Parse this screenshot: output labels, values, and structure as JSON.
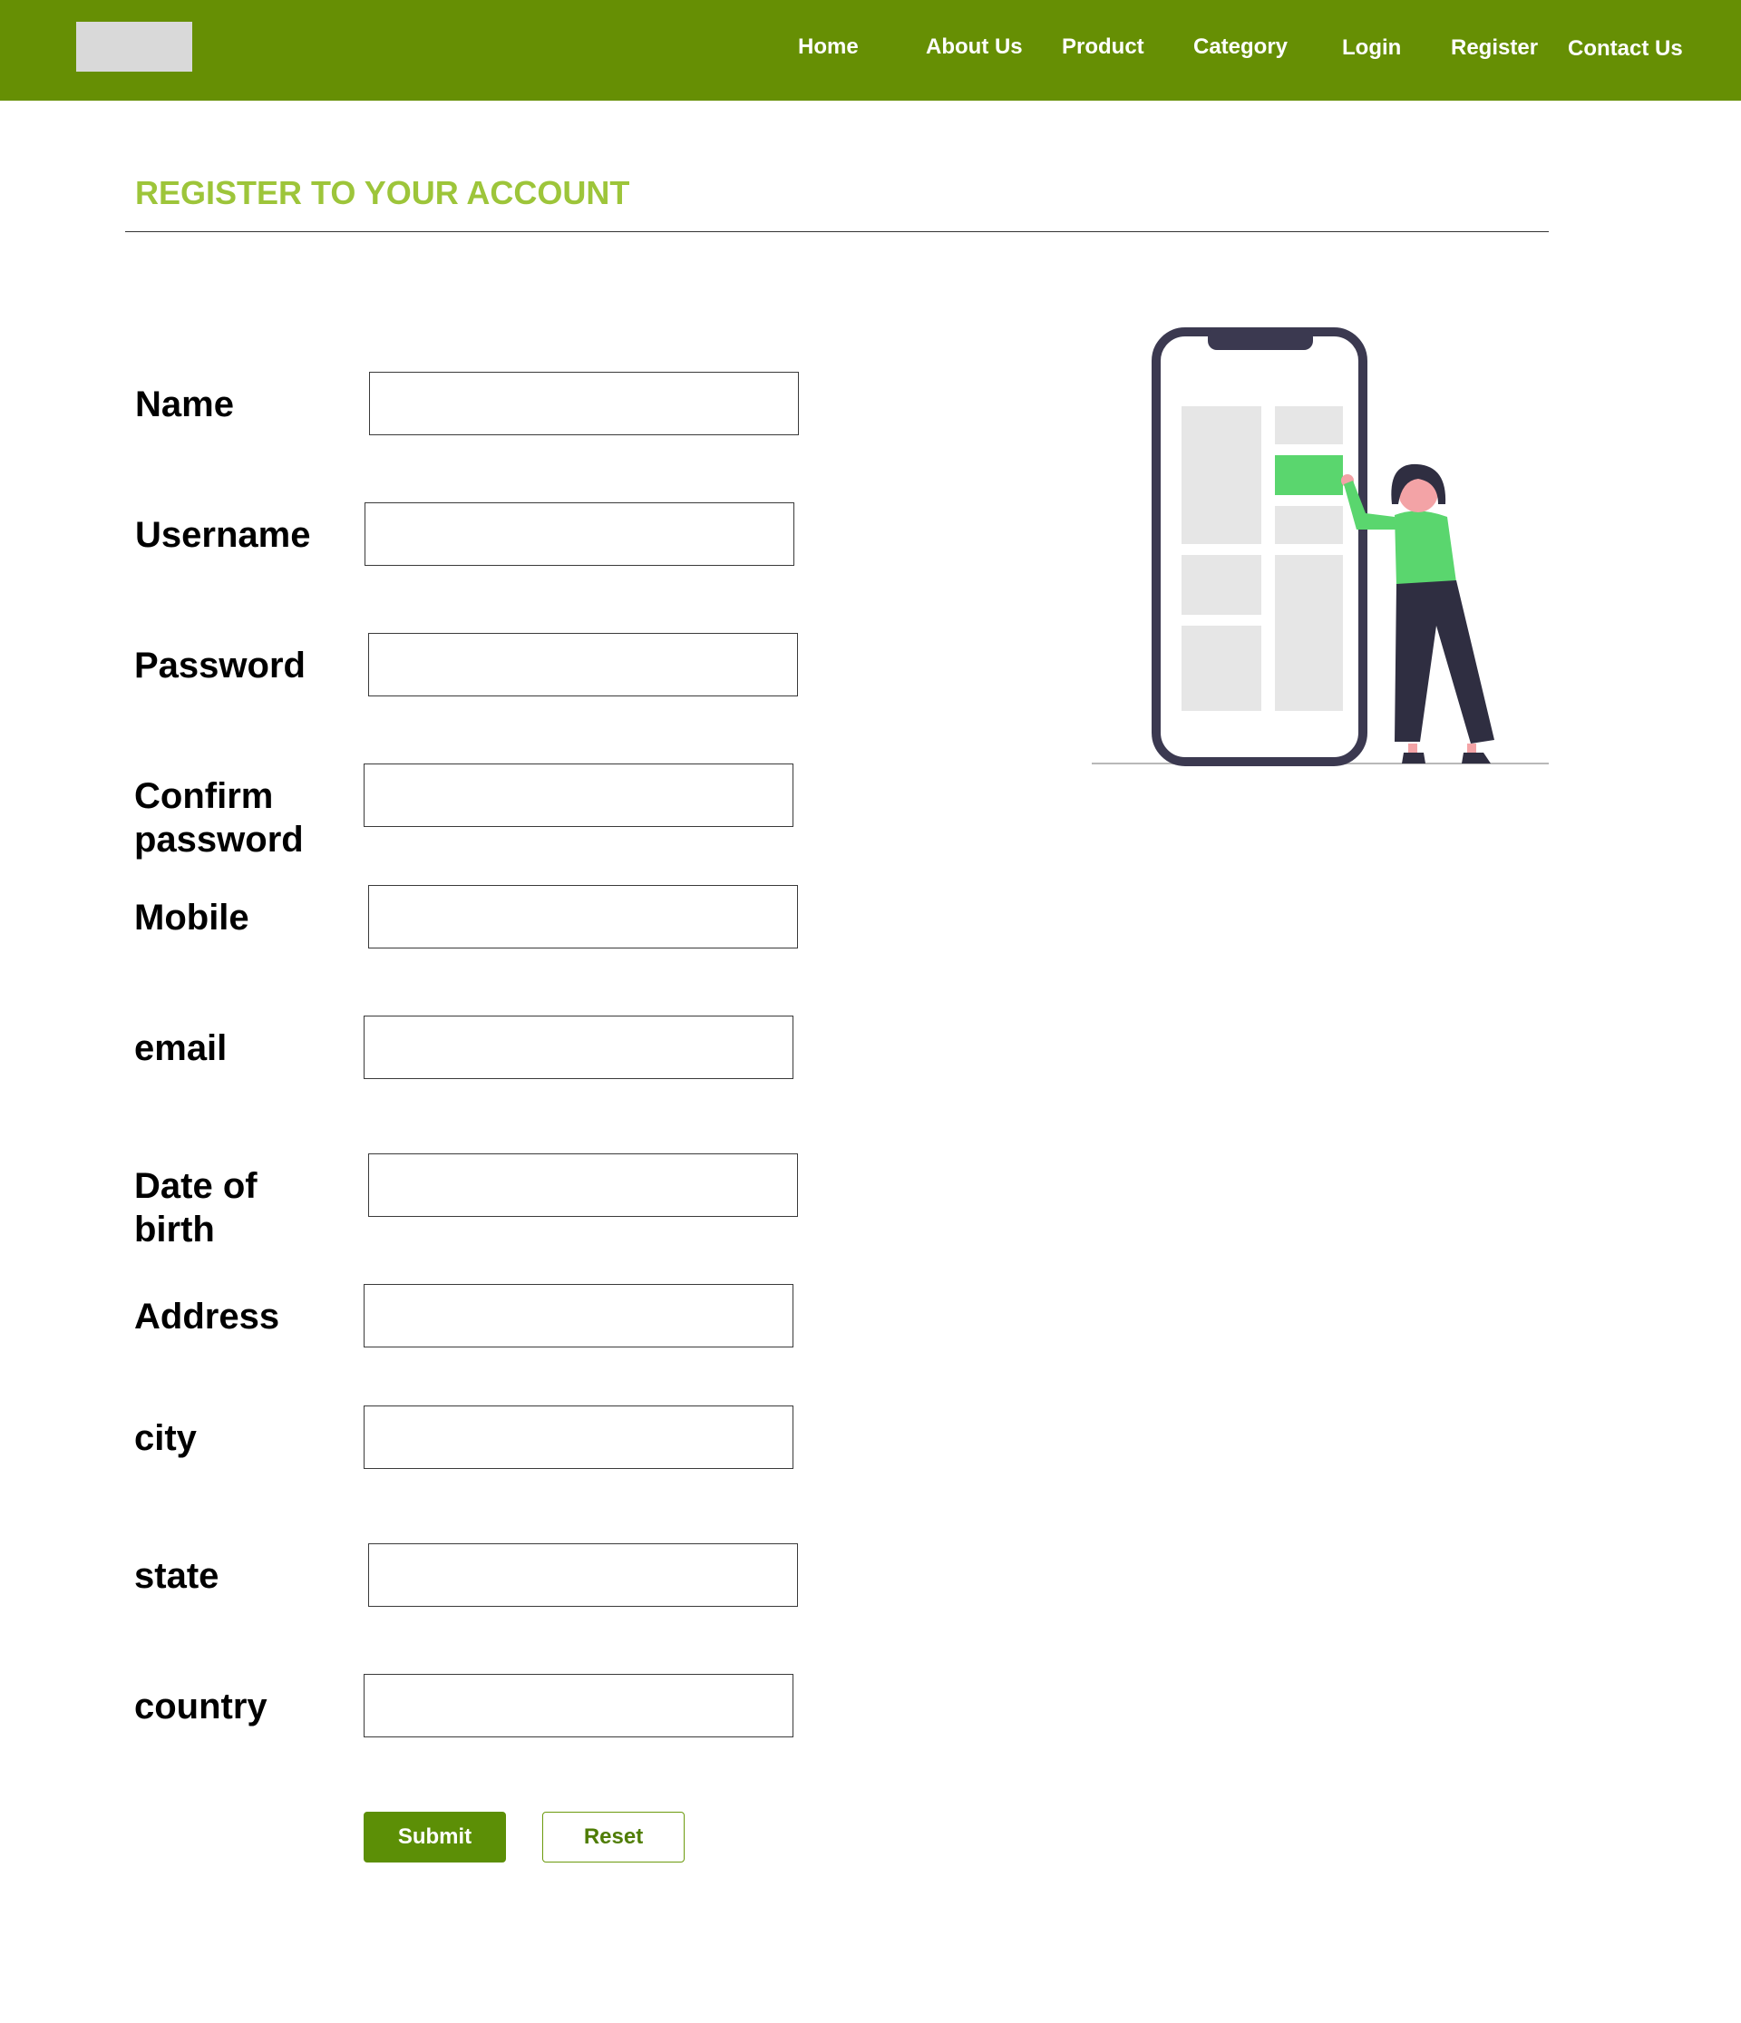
{
  "header": {
    "nav": [
      "Home",
      "About Us",
      "Product",
      "Category",
      "Login",
      "Register",
      "Contact Us"
    ]
  },
  "page": {
    "title": "REGISTER TO YOUR ACCOUNT"
  },
  "form": {
    "fields": [
      {
        "label": "Name",
        "value": ""
      },
      {
        "label": "Username",
        "value": ""
      },
      {
        "label": "Password",
        "value": ""
      },
      {
        "label": "Confirm password",
        "value": ""
      },
      {
        "label": "Mobile",
        "value": ""
      },
      {
        "label": "email",
        "value": ""
      },
      {
        "label": "Date of birth",
        "value": ""
      },
      {
        "label": "Address",
        "value": ""
      },
      {
        "label": "city",
        "value": ""
      },
      {
        "label": "state",
        "value": ""
      },
      {
        "label": "country",
        "value": ""
      }
    ],
    "submit_label": "Submit",
    "reset_label": "Reset"
  },
  "colors": {
    "header_bg": "#668f04",
    "title": "#9dc53a",
    "submit_bg": "#5c8f06",
    "illustration_accent": "#5ad66e",
    "illustration_dark": "#3b3950"
  },
  "icons": {
    "logo": "logo-placeholder",
    "illustration": "person-with-phone-illustration"
  }
}
